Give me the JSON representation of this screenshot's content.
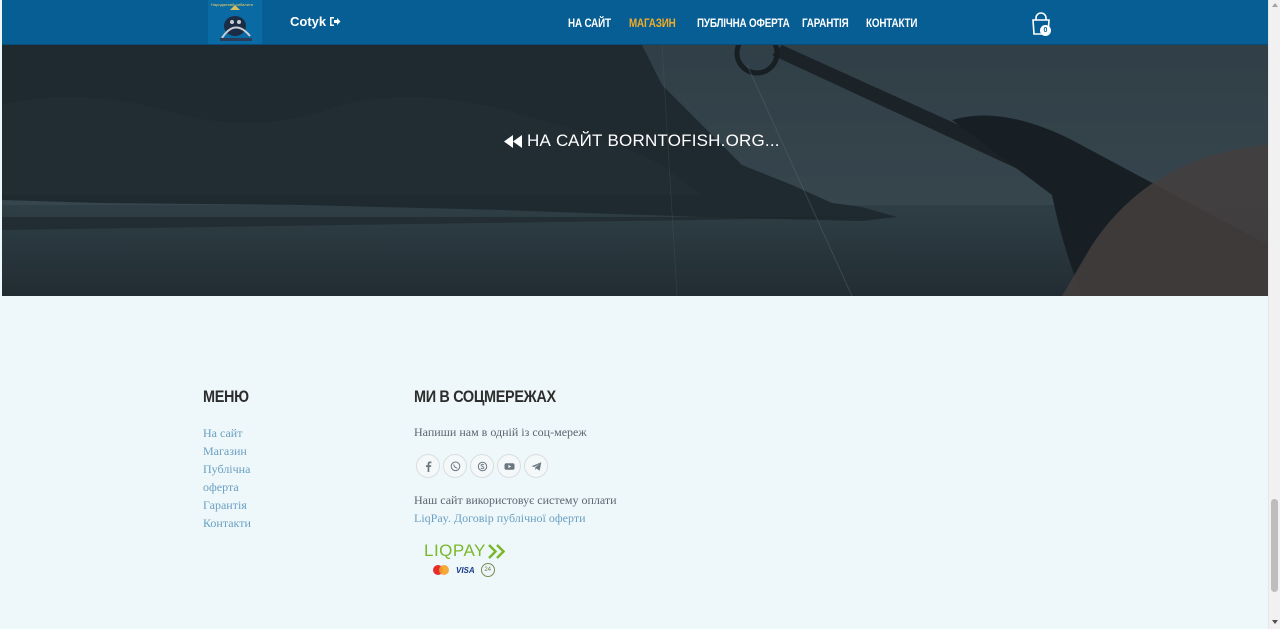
{
  "header": {
    "user_label": "Cotyk",
    "nav": [
      {
        "label": "НА САЙТ",
        "active": false
      },
      {
        "label": "МАГАЗИН",
        "active": true
      },
      {
        "label": "ПУБЛІЧНА ОФЕРТА",
        "active": false
      },
      {
        "label": "ГАРАНТІЯ",
        "active": false
      },
      {
        "label": "КОНТАКТИ",
        "active": false
      }
    ],
    "cart_count": "0"
  },
  "hero": {
    "link_label": "НА САЙТ BORNTOFISH.ORG..."
  },
  "footer": {
    "menu_title": "МЕНЮ",
    "menu_items": [
      "На сайт",
      "Магазин",
      "Публічна",
      "оферта",
      "Гарантія",
      "Контакти"
    ],
    "social_title": "МИ В СОЦМЕРЕЖАХ",
    "social_text": "Напиши нам в одній із соц-мереж",
    "social_icons": [
      "facebook-icon",
      "viber-icon",
      "skype-icon",
      "youtube-icon",
      "telegram-icon"
    ],
    "payment_text": "Наш сайт використовує систему оплати",
    "payment_link1": "LiqPay.",
    "payment_link2": "Договір публічної оферти",
    "liqpay_word": "LIQPAY",
    "visa_label": "VISA",
    "p24_label": "24"
  },
  "colors": {
    "header_bg": "#065e95",
    "active_nav": "#f0ad28",
    "footer_bg": "#eef8fa",
    "link": "#6a9fc3",
    "liqpay_green": "#7ab72b"
  }
}
